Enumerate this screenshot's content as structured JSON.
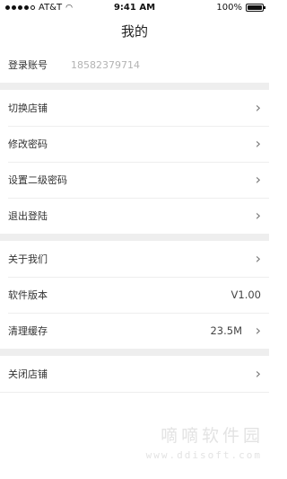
{
  "status": {
    "carrier": "AT&T",
    "time": "9:41 AM",
    "battery": "100%",
    "battery_level": 1.0
  },
  "nav": {
    "title": "我的"
  },
  "account": {
    "label": "登录账号",
    "value": "18582379714"
  },
  "group1": [
    {
      "label": "切换店铺"
    },
    {
      "label": "修改密码"
    },
    {
      "label": "设置二级密码"
    },
    {
      "label": "退出登陆"
    }
  ],
  "group2": [
    {
      "label": "关于我们"
    },
    {
      "label": "软件版本",
      "value": "V1.00"
    },
    {
      "label": "清理缓存",
      "value": "23.5M"
    }
  ],
  "group3": [
    {
      "label": "关闭店铺"
    }
  ],
  "watermark": {
    "text": "嘀嘀软件园",
    "url": "www.ddisoft.com"
  }
}
